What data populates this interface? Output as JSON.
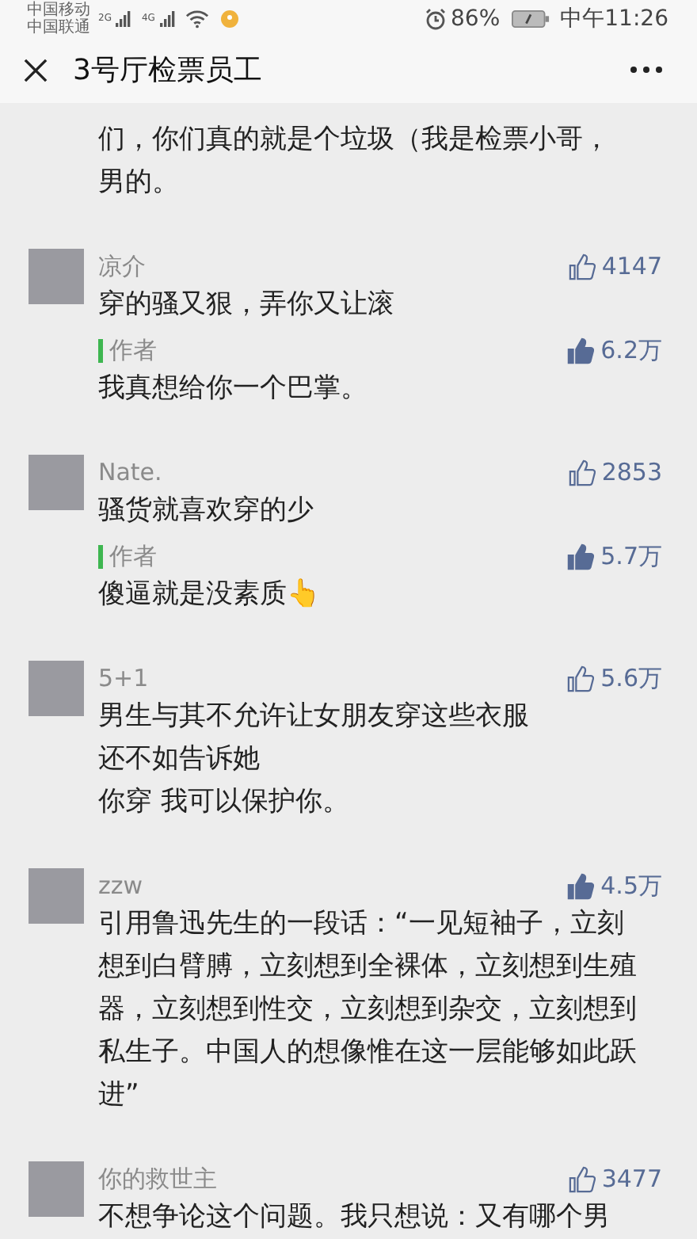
{
  "status_bar": {
    "carriers": [
      "中国移动",
      "中国联通"
    ],
    "network_1": "2G",
    "network_2": "4G",
    "battery": "86%",
    "time": "中午11:26"
  },
  "nav": {
    "title": "3号厅检票员工"
  },
  "partial_text": "们，你们真的就是个垃圾（我是检票小哥，男的。",
  "comments": [
    {
      "name": "凉介",
      "likes": "4147",
      "liked": false,
      "text": "穿的骚又狠，弄你又让滚",
      "reply": {
        "label": "作者",
        "likes": "6.2万",
        "liked": true,
        "text": "我真想给你一个巴掌。"
      }
    },
    {
      "name": "Nate.",
      "likes": "2853",
      "liked": false,
      "text": "骚货就喜欢穿的少",
      "reply": {
        "label": "作者",
        "likes": "5.7万",
        "liked": true,
        "text": "傻逼就是没素质👆"
      }
    },
    {
      "name": "5+1",
      "likes": "5.6万",
      "liked": false,
      "text": "男生与其不允许让女朋友穿这些衣服",
      "extra_lines": [
        "还不如告诉她",
        "你穿 我可以保护你。"
      ]
    },
    {
      "name": "zzw",
      "likes": "4.5万",
      "liked": true,
      "text": "引用鲁迅先生的一段话：“一见短袖子，立刻想到白臂膊，立刻想到全裸体，立刻想到生殖器，立刻想到性交，立刻想到杂交，立刻想到私生子。中国人的想像惟在这一层能够如此跃进”"
    },
    {
      "name": "你的救世主",
      "likes": "3477",
      "liked": false,
      "text": "不想争论这个问题。我只想说：又有哪个男"
    }
  ]
}
